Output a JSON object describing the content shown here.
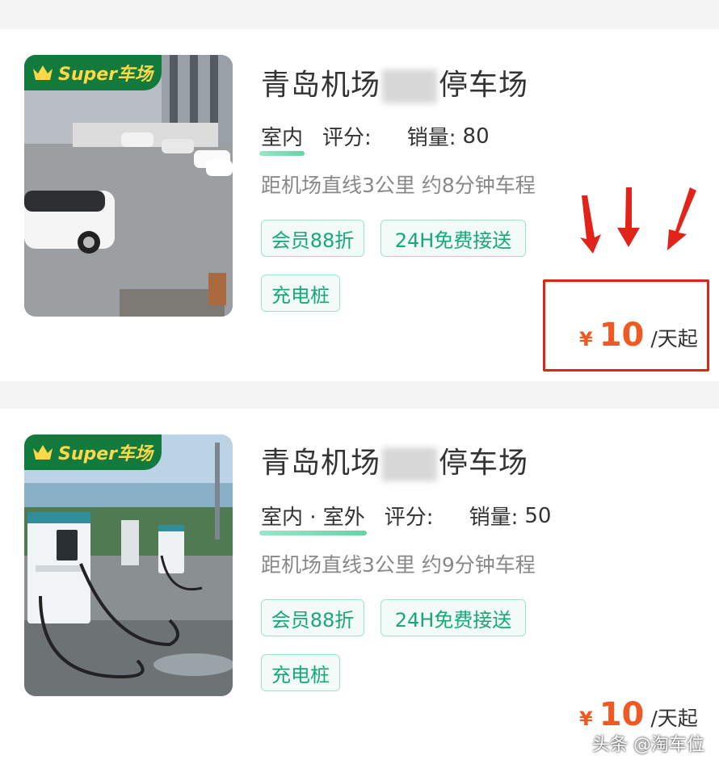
{
  "listings": [
    {
      "badge": "Super车场",
      "title_left": "青岛机场",
      "title_right": "停车场",
      "location": "室内",
      "rating_label": "评分:",
      "sales_label": "销量:",
      "sales_value": "80",
      "distance": "距机场直线3公里 约8分钟车程",
      "tags": [
        "会员88折",
        "24H免费接送",
        "充电桩"
      ],
      "price_symbol": "¥",
      "price_value": "10",
      "price_unit": "/天起"
    },
    {
      "badge": "Super车场",
      "title_left": "青岛机场",
      "title_right": "停车场",
      "location": "室内 · 室外",
      "rating_label": "评分:",
      "sales_label": "销量:",
      "sales_value": "50",
      "distance": "距机场直线3公里 约9分钟车程",
      "tags": [
        "会员88折",
        "24H免费接送",
        "充电桩"
      ],
      "price_symbol": "¥",
      "price_value": "10",
      "price_unit": "/天起"
    }
  ],
  "watermark": "头条 @淘车位",
  "colors": {
    "accent_green": "#17a875",
    "price_orange": "#f05a22",
    "highlight_red": "#e2231a",
    "badge_green": "#117a3c"
  }
}
